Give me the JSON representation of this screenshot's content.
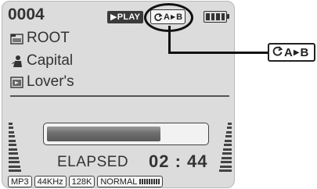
{
  "track": {
    "number": "0004"
  },
  "header": {
    "mode_label": "▶PLAY",
    "ab_repeat": {
      "a": "A",
      "arrow": "▶",
      "b": "B"
    },
    "battery_level": 1.0
  },
  "info": {
    "folder": "ROOT",
    "artist": "Capital",
    "title": "Lover's"
  },
  "playback": {
    "progress": 0.72,
    "elapsed_label": "ELAPSED",
    "elapsed_time": "02 : 44"
  },
  "status_bar": {
    "format": "MP3",
    "sample_rate": "44KHz",
    "bitrate": "128K",
    "eq_mode": "NORMAL"
  },
  "callout": {
    "a": "A",
    "arrow": "▶",
    "b": "B"
  },
  "icons": {
    "folder": "folder-icon",
    "artist": "artist-icon",
    "title": "title-icon",
    "repeat": "repeat-icon",
    "battery": "battery-icon"
  }
}
